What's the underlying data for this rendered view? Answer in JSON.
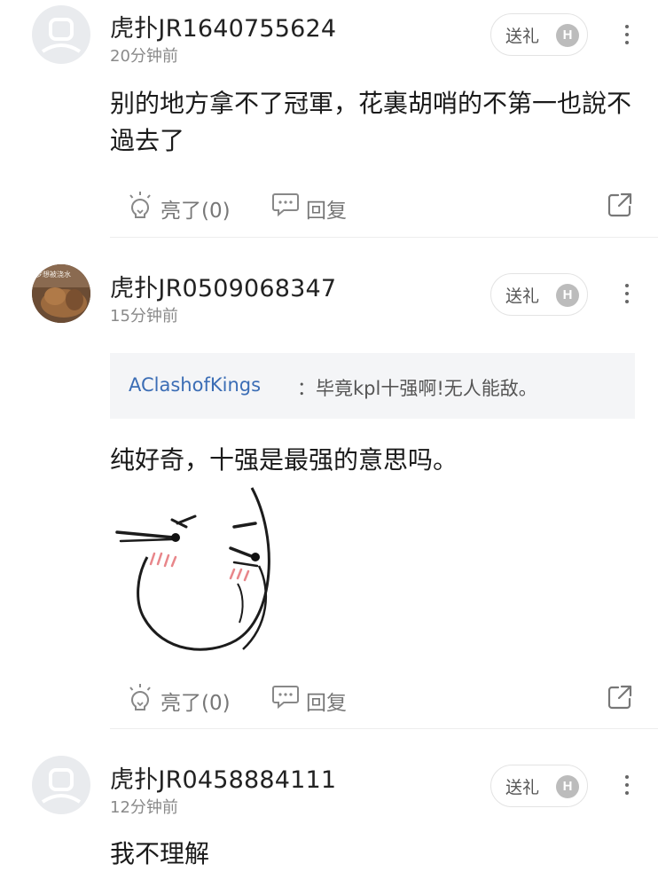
{
  "gift_label": "送礼",
  "gift_badge": "H",
  "like_label": "亮了(0)",
  "reply_label": "回复",
  "comments": [
    {
      "username": "虎扑JR1640755624",
      "time": "20分钟前",
      "text": "别的地方拿不了冠軍，花裏胡哨的不第一也說不過去了"
    },
    {
      "username": "虎扑JR0509068347",
      "time": "15分钟前",
      "avatar_caption": "梦想被浇水",
      "quote_author": "AClashofKings",
      "quote_text": "：毕竟kpl十强啊!无人能敌。",
      "text": "纯好奇，十强是最强的意思吗。"
    },
    {
      "username": "虎扑JR0458884111",
      "time": "12分钟前",
      "text": "我不理解"
    }
  ]
}
